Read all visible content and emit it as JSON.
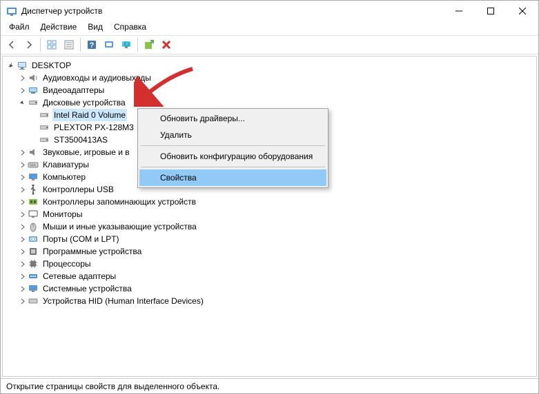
{
  "title": "Диспетчер устройств",
  "menubar": {
    "file": "Файл",
    "action": "Действие",
    "view": "Вид",
    "help": "Справка"
  },
  "tree": {
    "root": "DESKTOP",
    "categories": [
      {
        "label": "Аудиовходы и аудиовыходы",
        "expanded": false
      },
      {
        "label": "Видеоадаптеры",
        "expanded": false
      },
      {
        "label": "Дисковые устройства",
        "expanded": true,
        "children": [
          "Intel Raid 0 Volume",
          "PLEXTOR PX-128M3",
          "ST3500413AS"
        ]
      },
      {
        "label": "Звуковые, игровые и в"
      },
      {
        "label": "Клавиатуры"
      },
      {
        "label": "Компьютер"
      },
      {
        "label": "Контроллеры USB"
      },
      {
        "label": "Контроллеры запоминающих устройств"
      },
      {
        "label": "Мониторы"
      },
      {
        "label": "Мыши и иные указывающие устройства"
      },
      {
        "label": "Порты (COM и LPT)"
      },
      {
        "label": "Программные устройства"
      },
      {
        "label": "Процессоры"
      },
      {
        "label": "Сетевые адаптеры"
      },
      {
        "label": "Системные устройства"
      },
      {
        "label": "Устройства HID (Human Interface Devices)"
      }
    ]
  },
  "context_menu": {
    "update_drivers": "Обновить драйверы...",
    "delete": "Удалить",
    "update_config": "Обновить конфигурацию оборудования",
    "properties": "Свойства"
  },
  "statusbar": "Открытие страницы свойств для выделенного объекта."
}
